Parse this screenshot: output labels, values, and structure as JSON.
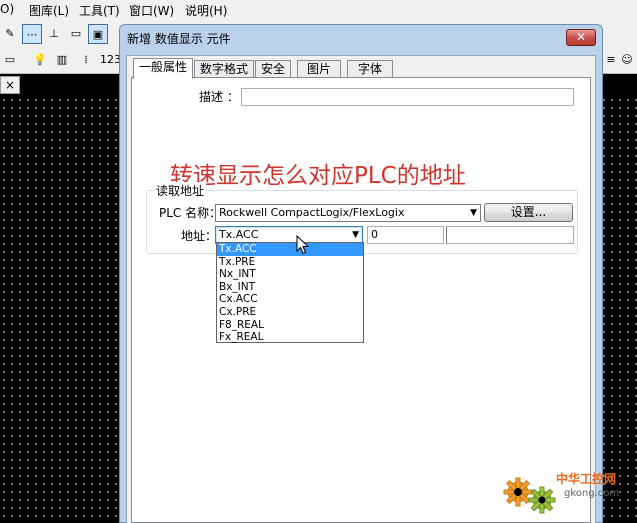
{
  "menubar": {
    "items": [
      {
        "label": "O)"
      },
      {
        "label": "图库(L)"
      },
      {
        "label": "工具(T)"
      },
      {
        "label": "窗口(W)"
      },
      {
        "label": "说明(H)"
      }
    ]
  },
  "toolbar": {
    "row1": [
      "✎",
      "⋯",
      "⊥",
      "▭",
      "▣"
    ],
    "row2": [
      "💡",
      "▥",
      "⁞",
      "123"
    ],
    "right": [
      "≡",
      "☺"
    ]
  },
  "doc_tab": {
    "close": "×"
  },
  "dialog": {
    "title": "新增 数值显示 元件",
    "close": "✕",
    "tabs": [
      {
        "label": "一般属性",
        "active": true
      },
      {
        "label": "数字格式",
        "active": false
      },
      {
        "label": "安全",
        "active": false
      },
      {
        "label": "图片",
        "active": false
      },
      {
        "label": "字体",
        "active": false
      }
    ],
    "description_label": "描述 ：",
    "description_value": "",
    "annotation": "转速显示怎么对应PLC的地址",
    "read_address_group": "读取地址",
    "plc_name_label": "PLC 名称：",
    "plc_name_value": "Rockwell CompactLogix/FlexLogix",
    "settings_button": "设置...",
    "address_label": "地址：",
    "address_selected": "Tx.ACC",
    "address_number": "0",
    "address_options": [
      "Tx.ACC",
      "Tx.PRE",
      "Nx_INT",
      "Bx_INT",
      "Cx.ACC",
      "Cx.PRE",
      "F8_REAL",
      "Fx_REAL"
    ]
  },
  "watermark": {
    "line1": "中华工控网",
    "line2": "gkong.com"
  },
  "colors": {
    "annotation": "#d0342c",
    "selection": "#3399ff",
    "dialog_frame": "#b9d1ea"
  }
}
